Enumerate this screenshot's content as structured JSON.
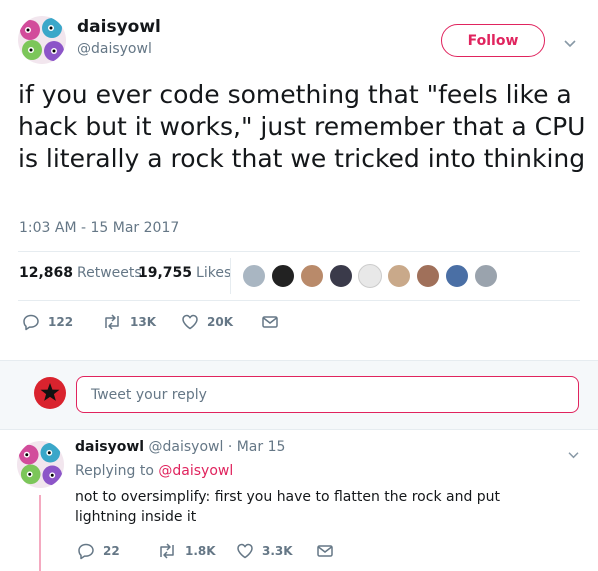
{
  "tweet": {
    "display_name": "daisyowl",
    "handle": "@daisyowl",
    "follow_label": "Follow",
    "text": "if you ever code something that \"feels like a hack but it works,\" just remember that a CPU is literally a rock that we tricked into thinking",
    "timestamp": "1:03 AM - 15 Mar 2017",
    "retweets_count": "12,868",
    "retweets_label": "Retweets",
    "likes_count": "19,755",
    "likes_label": "Likes",
    "actions": {
      "replies": "122",
      "retweets": "13K",
      "likes": "20K"
    }
  },
  "reply_box": {
    "placeholder": "Tweet your reply"
  },
  "reply": {
    "display_name": "daisyowl",
    "handle_date": "@daisyowl · Mar 15",
    "replying_prefix": "Replying to",
    "replying_to": "@daisyowl",
    "text": "not to oversimplify: first you have to flatten the rock and put lightning inside it",
    "actions": {
      "replies": "22",
      "retweets": "1.8K",
      "likes": "3.3K"
    }
  },
  "colors": {
    "accent": "#e0245e",
    "secondary_text": "#657786",
    "divider": "#e6ecf0",
    "thread_line": "#f4a9c0"
  },
  "icons": [
    "caret-down-icon",
    "reply-icon",
    "retweet-icon",
    "heart-icon",
    "dm-envelope-icon"
  ]
}
